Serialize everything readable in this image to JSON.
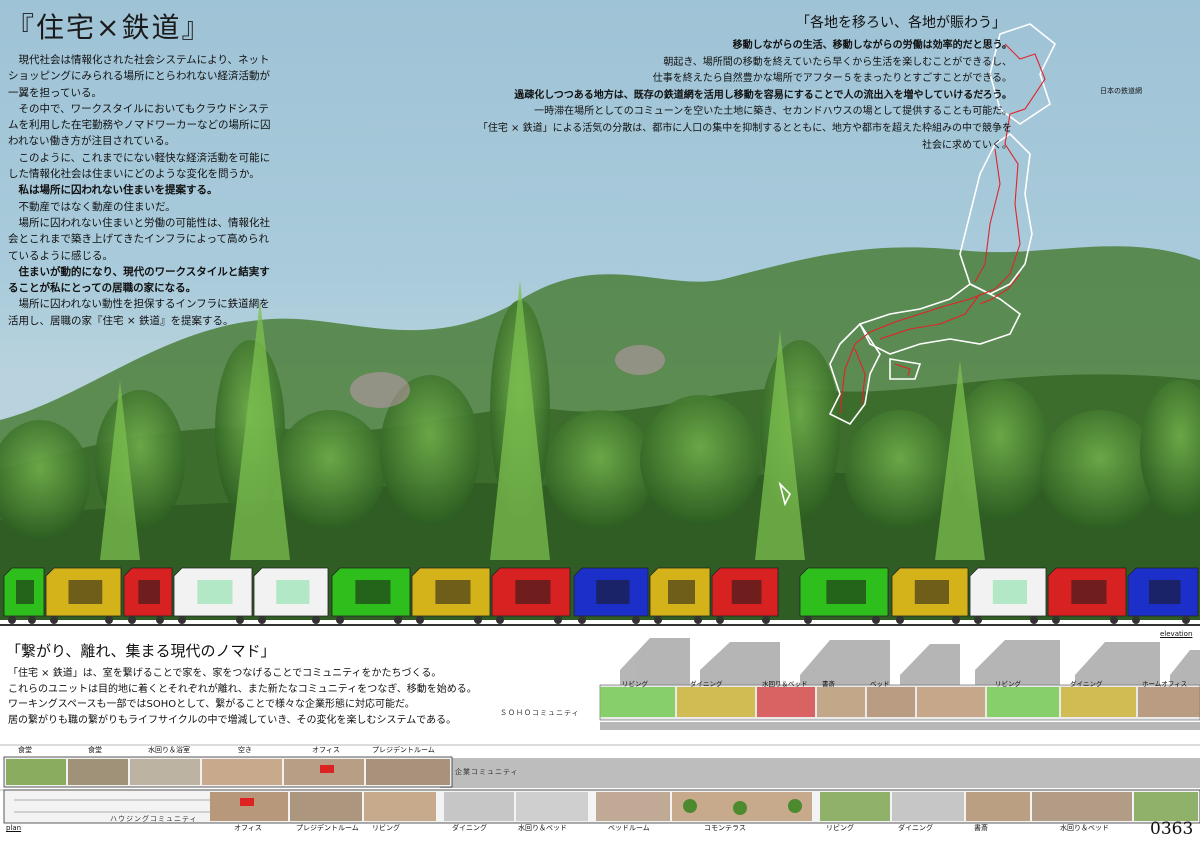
{
  "title": "『住宅×鉄道』",
  "intro_paragraphs": [
    {
      "text": "現代社会は情報化された社会システムにより、ネットショッピングにみられる場所にとらわれない経済活動が一翼を担っている。",
      "bold": false
    },
    {
      "text": "その中で、ワークスタイルにおいてもクラウドシステムを利用した在宅勤務やノマドワーカーなどの場所に囚われない働き方が注目されている。",
      "bold": false
    },
    {
      "text": "このように、これまでにない軽快な経済活動を可能にした情報化社会は住まいにどのような変化を問うか。",
      "bold": false
    },
    {
      "text": "私は場所に囚われない住まいを提案する。",
      "bold": true
    },
    {
      "text": "不動産ではなく動産の住まいだ。",
      "bold": false
    },
    {
      "text": "場所に囚われない住まいと労働の可能性は、情報化社会とこれまで築き上げてきたインフラによって高められているように感じる。",
      "bold": false
    },
    {
      "text": "住まいが動的になり、現代のワークスタイルと結実することが私にとっての居職の家になる。",
      "bold": true
    },
    {
      "text": "場所に囚われない動性を担保するインフラに鉄道網を活用し、居職の家『住宅 × 鉄道』を提案する。",
      "bold": false
    }
  ],
  "quote_title": "「各地を移ろい、各地が賑わう」",
  "quote_lines": [
    "移動しながらの生活、移動しながらの労働は効率的だと思う。",
    "朝起き、場所間の移動を終えていたら早くから生活を楽しむことができるし、",
    "仕事を終えたら自然豊かな場所でアフター５をまったりとすごすことができる。",
    "過疎化しつつある地方は、既存の鉄道網を活用し移動を容易にすることで人の流出入を増やしていけるだろう。",
    "一時滞在場所としてのコミューンを空いた土地に築き、セカンドハウスの場として提供することも可能だ。",
    "「住宅 × 鉄道」による活気の分散は、都市に人口の集中を抑制するとともに、地方や都市を超えた枠組みの中で競争を",
    "社会に求めていく。"
  ],
  "map_label": "日本の鉄道網",
  "elevation_label": "elevation",
  "section2_title": "「繋がり、離れ、集まる現代のノマド」",
  "section2_lines": [
    "「住宅 × 鉄道」は、室を繋げることで家を、家をつなげることでコミュニティをかたちづくる。",
    "これらのユニットは目的地に着くとそれぞれが離れ、また新たなコミュニティをつなぎ、移動を始める。",
    "ワーキングスペースも一部ではSOHOとして、繋がることで様々な企業形態に対応可能だ。",
    "居の繋がりも職の繋がりもライフサイクルの中で増減していき、その変化を楽しむシステムである。"
  ],
  "upper_plan_labels": [
    "リビング",
    "ダイニング",
    "水回り＆ベッド",
    "書斎",
    "ベッド",
    "リビング",
    "ダイニング",
    "ホームオフィス"
  ],
  "middle_plan_labels": [
    "食堂",
    "食堂",
    "水回り＆浴室",
    "空き",
    "オフィス",
    "プレジデントルーム"
  ],
  "community_labels": [
    "ＳＯＨＯコミュニティ",
    "企業コミュニティ",
    "ハウジングコミュニティ"
  ],
  "bottom_plan_labels": [
    "オフィス",
    "プレジデントルーム",
    "リビング",
    "ダイニング",
    "水回り＆ベッド",
    "ベッドルーム",
    "コモンテラス",
    "リビング",
    "ダイニング",
    "書斎",
    "水回り＆ベッド"
  ],
  "plan_label": "plan",
  "sheet_number": "0363",
  "colors": {
    "sky": "#a6c8d9",
    "forest": "#3f7a2e",
    "unit_green": "#2fbf1c",
    "unit_yellow": "#d4b21a",
    "unit_red": "#d82222",
    "unit_blue": "#1c2fc8",
    "unit_white": "#f2f2f2",
    "rail_map": "#e0232a"
  }
}
